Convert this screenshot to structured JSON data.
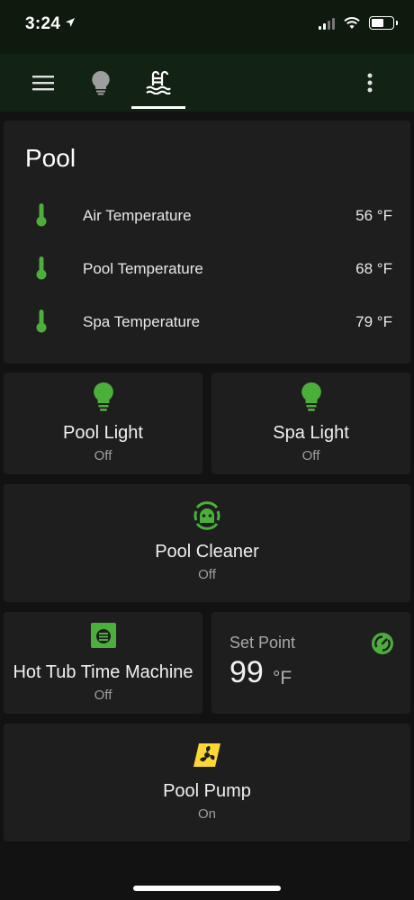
{
  "status_bar": {
    "time": "3:24"
  },
  "toolbar": {
    "menu_icon": "menu-icon",
    "tabs": [
      {
        "icon": "lightbulb-icon",
        "active": false
      },
      {
        "icon": "pool-ladder-icon",
        "active": true
      }
    ],
    "more_icon": "more-vertical-icon"
  },
  "pool": {
    "title": "Pool",
    "sensors": [
      {
        "icon": "thermometer-icon",
        "name": "Air Temperature",
        "value": "56 °F"
      },
      {
        "icon": "thermometer-icon",
        "name": "Pool Temperature",
        "value": "68 °F"
      },
      {
        "icon": "thermometer-icon",
        "name": "Spa Temperature",
        "value": "79 °F"
      }
    ]
  },
  "tiles": {
    "pool_light": {
      "name": "Pool Light",
      "state": "Off",
      "icon": "lightbulb-icon"
    },
    "spa_light": {
      "name": "Spa Light",
      "state": "Off",
      "icon": "lightbulb-icon"
    },
    "pool_cleaner": {
      "name": "Pool Cleaner",
      "state": "Off",
      "icon": "robot-vacuum-icon"
    },
    "hot_tub": {
      "name": "Hot Tub Time Machine",
      "state": "Off",
      "icon": "tumble-dryer-icon"
    },
    "set_point": {
      "label": "Set Point",
      "value": "99",
      "unit": "°F",
      "icon": "thermostat-dial-icon"
    },
    "pool_pump": {
      "name": "Pool Pump",
      "state": "On",
      "icon": "fan-icon"
    }
  },
  "colors": {
    "accent_green": "#4caf3c",
    "active_yellow": "#fdd835",
    "card_bg": "#1e1e1e",
    "app_bg": "#121212",
    "toolbar_bg": "#132313"
  }
}
